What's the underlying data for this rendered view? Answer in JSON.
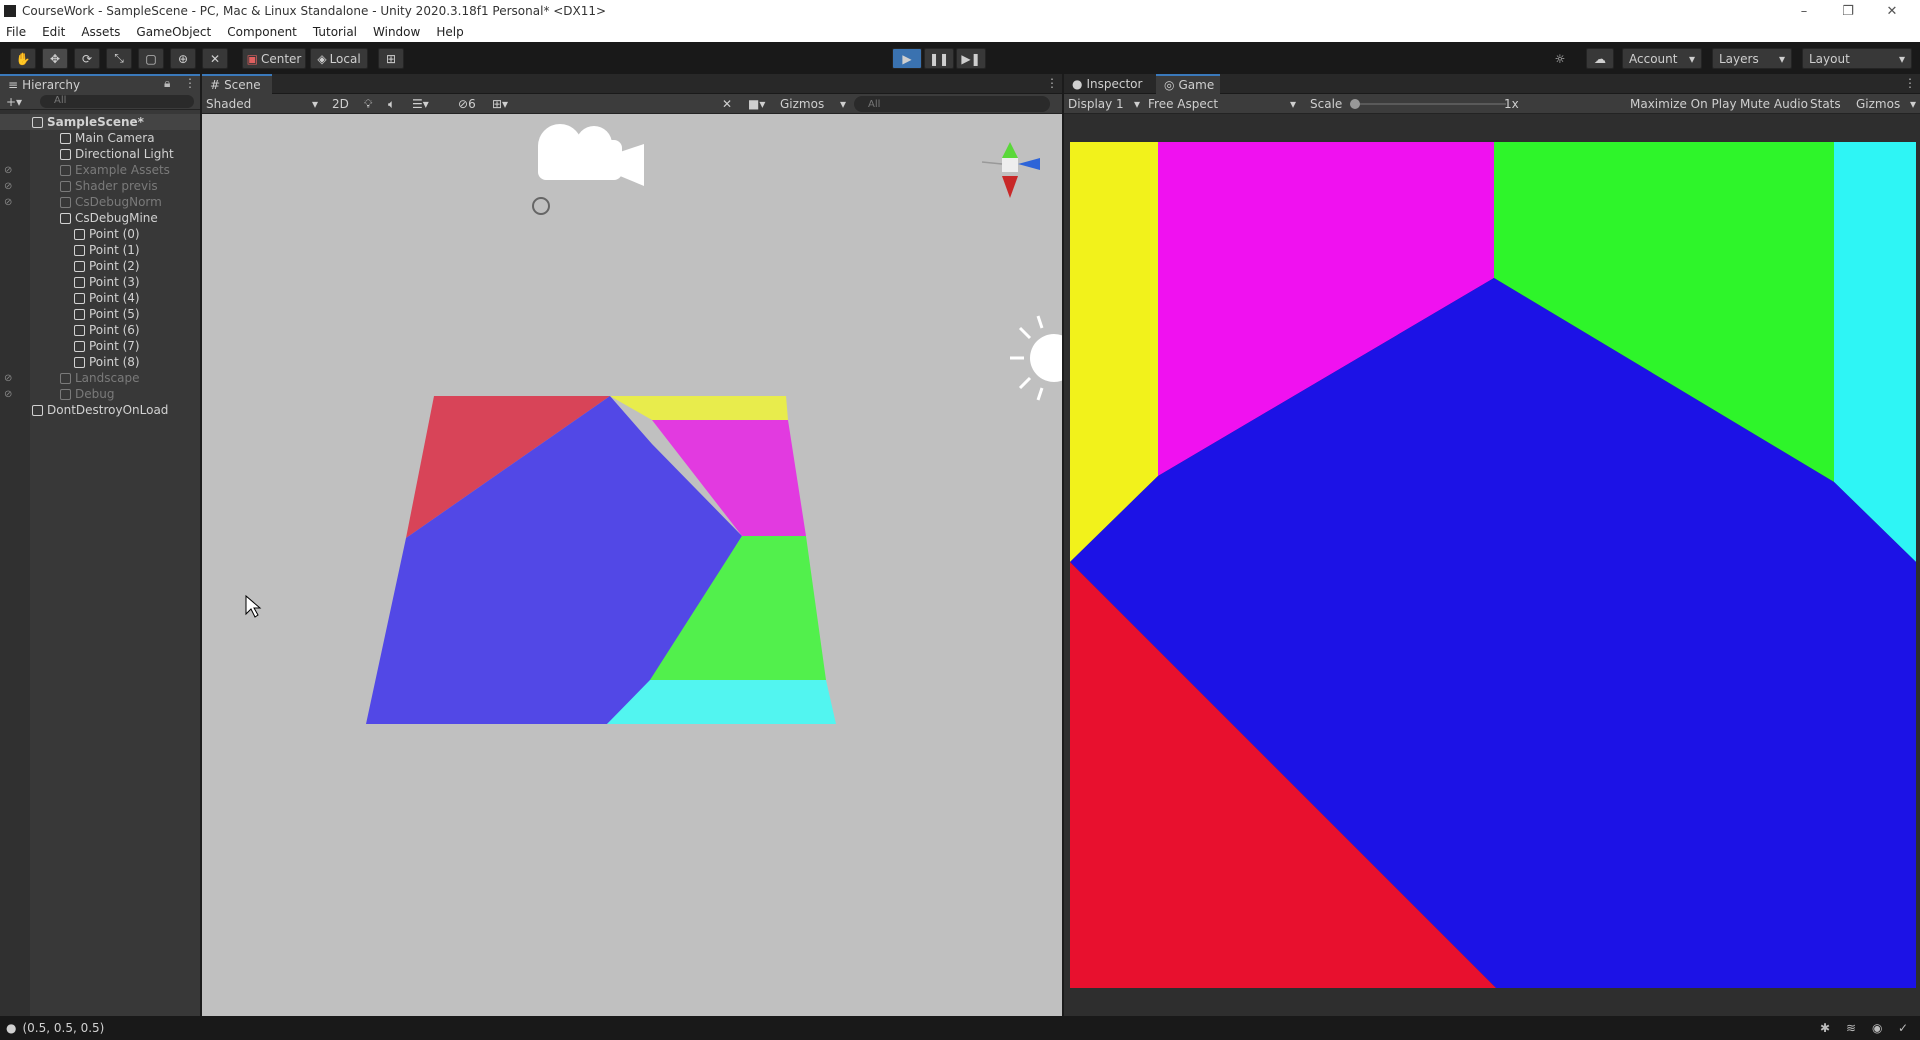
{
  "window": {
    "title": "CourseWork - SampleScene - PC, Mac & Linux Standalone - Unity 2020.3.18f1 Personal* <DX11>",
    "controls": [
      "–",
      "❐",
      "✕"
    ]
  },
  "menu": [
    "File",
    "Edit",
    "Assets",
    "GameObject",
    "Component",
    "Tutorial",
    "Window",
    "Help"
  ],
  "toolbar": {
    "pivot_label": "Center",
    "space_label": "Local",
    "account_label": "Account",
    "layers_label": "Layers",
    "layout_label": "Layout"
  },
  "hierarchy": {
    "tab_label": "Hierarchy",
    "search_placeholder": "All",
    "items": [
      {
        "label": "SampleScene*",
        "indent": 0,
        "kind": "scene",
        "dim": false
      },
      {
        "label": "Main Camera",
        "indent": 1,
        "kind": "object",
        "dim": false
      },
      {
        "label": "Directional Light",
        "indent": 1,
        "kind": "object",
        "dim": false
      },
      {
        "label": "Example Assets",
        "indent": 1,
        "kind": "object",
        "dim": true
      },
      {
        "label": "Shader previs",
        "indent": 1,
        "kind": "object",
        "dim": true
      },
      {
        "label": "CsDebugNorm",
        "indent": 1,
        "kind": "object",
        "dim": true
      },
      {
        "label": "CsDebugMine",
        "indent": 1,
        "kind": "object",
        "dim": false
      },
      {
        "label": "Point (0)",
        "indent": 2,
        "kind": "object",
        "dim": false
      },
      {
        "label": "Point (1)",
        "indent": 2,
        "kind": "object",
        "dim": false
      },
      {
        "label": "Point (2)",
        "indent": 2,
        "kind": "object",
        "dim": false
      },
      {
        "label": "Point (3)",
        "indent": 2,
        "kind": "object",
        "dim": false
      },
      {
        "label": "Point (4)",
        "indent": 2,
        "kind": "object",
        "dim": false
      },
      {
        "label": "Point (5)",
        "indent": 2,
        "kind": "object",
        "dim": false
      },
      {
        "label": "Point (6)",
        "indent": 2,
        "kind": "object",
        "dim": false
      },
      {
        "label": "Point (7)",
        "indent": 2,
        "kind": "object",
        "dim": false
      },
      {
        "label": "Point (8)",
        "indent": 2,
        "kind": "object",
        "dim": false
      },
      {
        "label": "Landscape",
        "indent": 1,
        "kind": "object",
        "dim": true
      },
      {
        "label": "Debug",
        "indent": 1,
        "kind": "object",
        "dim": true
      },
      {
        "label": "DontDestroyOnLoad",
        "indent": 0,
        "kind": "scene",
        "dim": false
      }
    ]
  },
  "scene": {
    "tab_label": "Scene",
    "shading_mode": "Shaded",
    "mode_2d": "2D",
    "fx_count": "6",
    "gizmos_label": "Gizmos",
    "search_placeholder": "All"
  },
  "game": {
    "inspector_tab": "Inspector",
    "tab_label": "Game",
    "display": "Display 1",
    "aspect": "Free Aspect",
    "scale_label": "Scale",
    "scale_value": "1x",
    "maximize_label": "Maximize On Play",
    "mute_label": "Mute Audio",
    "stats_label": "Stats",
    "gizmos_label": "Gizmos"
  },
  "colors": {
    "yellow": "#f2f21b",
    "magenta": "#f011f0",
    "green": "#2ef52a",
    "cyan": "#2ef5f5",
    "blue": "#1c12e6",
    "red": "#e8102e",
    "scene_red": "#d84458",
    "scene_blue": "#5248e6",
    "scene_magenta": "#e23ae0",
    "scene_green": "#52f04c",
    "scene_cyan": "#52f5f0",
    "scene_yellow": "#e8ec4c"
  },
  "status": {
    "message": "(0.5, 0.5, 0.5)"
  }
}
